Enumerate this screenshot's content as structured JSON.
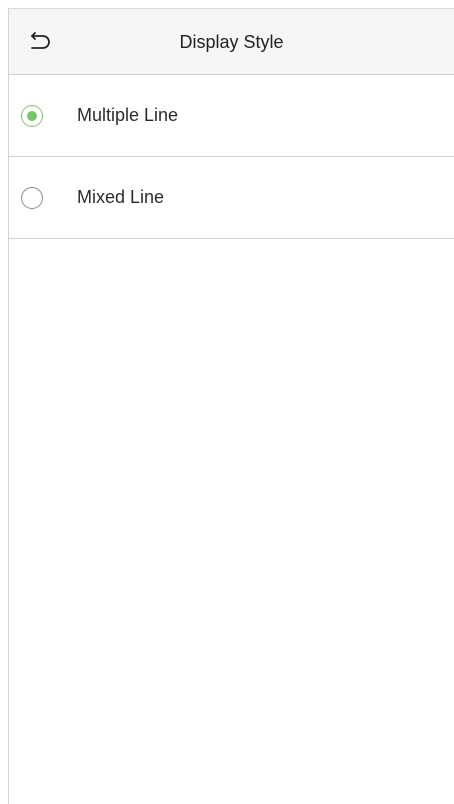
{
  "header": {
    "title": "Display Style",
    "back_icon": "back-arrow-icon"
  },
  "options": [
    {
      "label": "Multiple Line",
      "selected": true
    },
    {
      "label": "Mixed Line",
      "selected": false
    }
  ],
  "colors": {
    "accent": "#7cc46a",
    "divider": "#d2d2d2",
    "header_bg": "#f6f6f6"
  }
}
